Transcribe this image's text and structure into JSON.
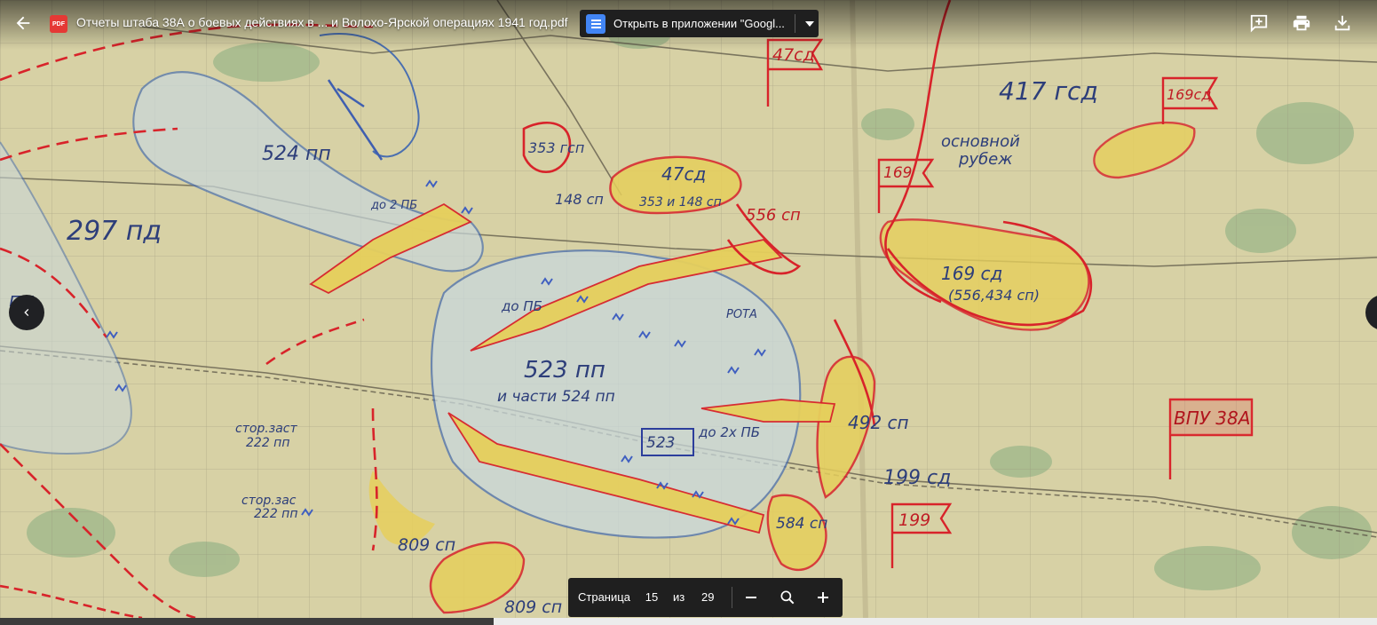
{
  "header": {
    "back_icon": "arrow-back-icon",
    "file_type_badge": "PDF",
    "title": "Отчеты штаба 38А о боевых действиях в ... и Волохо-Ярской операциях 1941 год.pdf",
    "open_with_label": "Открыть в приложении \"Googl...",
    "open_with_icon": "google-docs-icon",
    "actions": [
      "add-to-drive-icon",
      "print-icon",
      "download-icon"
    ]
  },
  "navigation": {
    "prev_icon": "chevron-left-icon",
    "next_icon": "chevron-right-icon"
  },
  "pager": {
    "page_label": "Страница",
    "current_page": "15",
    "of_label": "из",
    "total_pages": "29",
    "zoom_out_icon": "minus-icon",
    "zoom_icon": "magnifier-icon",
    "zoom_in_icon": "plus-icon"
  },
  "map": {
    "labels": {
      "d47": "47сд",
      "d47b": "47сд",
      "d417": "417 гсд",
      "d169a": "169сд",
      "p524": "524 пп",
      "g353": "353 гсп",
      "g148": "148 сп",
      "m353": "353 и 148 сп",
      "p556": "556 сп",
      "d297": "297 пд",
      "main": "основной",
      "rubezh": "рубеж",
      "s169": "169",
      "d169": "169 сд",
      "d169sub": "(556,434 сп)",
      "pb": "до 2 ПБ",
      "pb2": "до ПБ",
      "rota": "РОТА",
      "p523": "523 пп",
      "p523b": "и части 524 пп",
      "box523": "523",
      "pb3": "до 2х ПБ",
      "c492": "492 сп",
      "vpu": "ВПУ 38А",
      "d199": "199 сд",
      "f199": "199",
      "c584": "584 сп",
      "c809": "809 сп",
      "c809b": "809 сп",
      "st1": "стор.заст",
      "st1b": "222 пп",
      "st2": "стор.зас",
      "st2b": "222 пп",
      "pp": "пп"
    },
    "colors": {
      "paper": "#d6d0a8",
      "blue_line": "#4a6fb0",
      "red_line": "#d8232a",
      "yellow_fill": "#e6cf5c",
      "blue_fill": "#c9d8dc",
      "text": "#2d3e7a"
    }
  }
}
